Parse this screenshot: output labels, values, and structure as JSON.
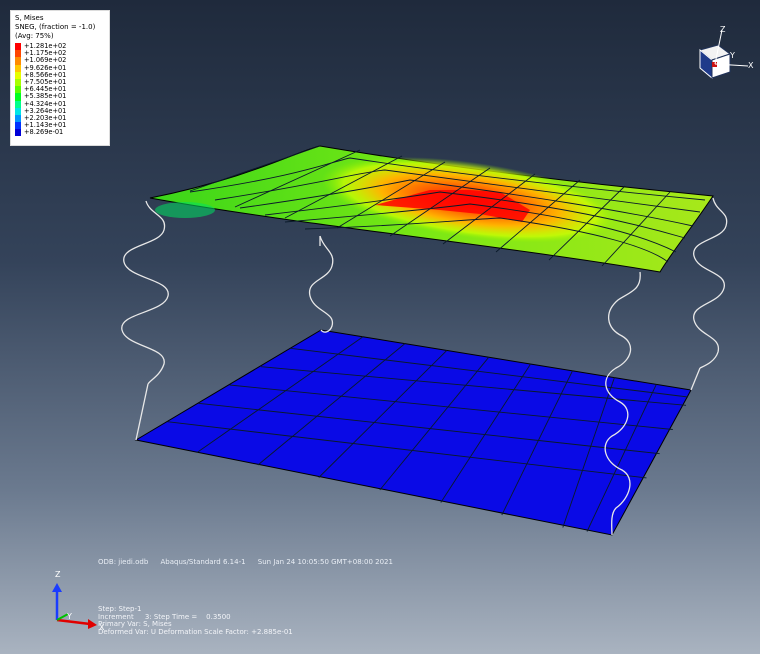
{
  "legend": {
    "title": "S, Mises",
    "subtitle": "SNEG, (fraction = -1.0)",
    "averaging": "(Avg: 75%)",
    "entries": [
      {
        "value": "+1.281e+02",
        "color": "#ff0000"
      },
      {
        "value": "+1.175e+02",
        "color": "#ff4600"
      },
      {
        "value": "+1.069e+02",
        "color": "#ff8c00"
      },
      {
        "value": "+9.626e+01",
        "color": "#ffc800"
      },
      {
        "value": "+8.566e+01",
        "color": "#e6ff00"
      },
      {
        "value": "+7.505e+01",
        "color": "#a8ff00"
      },
      {
        "value": "+6.445e+01",
        "color": "#5aff00"
      },
      {
        "value": "+5.385e+01",
        "color": "#00ff20"
      },
      {
        "value": "+4.324e+01",
        "color": "#00ff8c"
      },
      {
        "value": "+3.264e+01",
        "color": "#00e6e6"
      },
      {
        "value": "+2.203e+01",
        "color": "#0096ff"
      },
      {
        "value": "+1.143e+01",
        "color": "#0032ff"
      },
      {
        "value": "+8.269e-01",
        "color": "#0000d8"
      }
    ]
  },
  "info": {
    "odb": "ODB: jiedi.odb",
    "solver": "Abaqus/Standard 6.14-1",
    "date": "Sun Jan 24 10:05:50 GMT+08:00 2021"
  },
  "step": {
    "step": "Step: Step-1",
    "increment": "Increment     3: Step Time =    0.3500",
    "primary": "Primary Var: S, Mises",
    "deformed": "Deformed Var: U   Deformation Scale Factor: +2.885e-01"
  },
  "triad": {
    "z_label": "Z",
    "y_label": "Y",
    "x_label": "X"
  },
  "colors": {
    "bottom_plate": "#0a0ae6",
    "mesh_line": "#0a1a2a",
    "spring_line": "#e8e8e8"
  }
}
